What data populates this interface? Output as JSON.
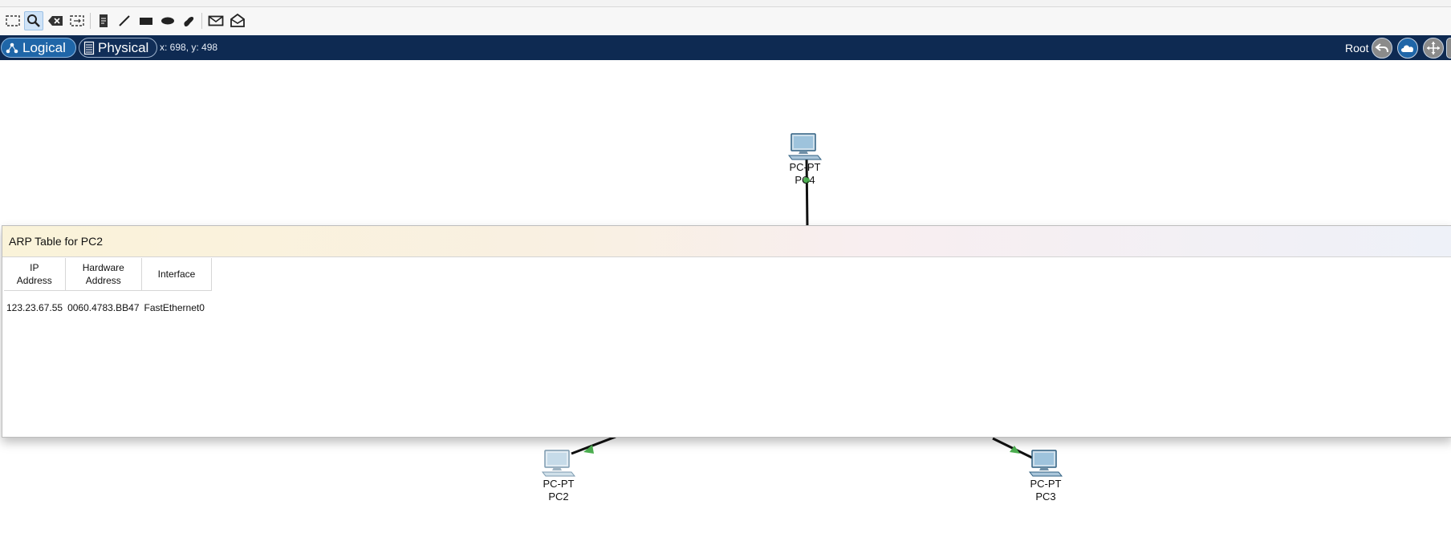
{
  "toolbar": {
    "tools": [
      "select-icon",
      "inspect-icon",
      "delete-icon",
      "resize-icon",
      "note-icon",
      "line-icon",
      "rectangle-icon",
      "ellipse-icon",
      "freeform-icon",
      "simple-pdu-icon",
      "complex-pdu-icon"
    ],
    "active_tool": "inspect-icon"
  },
  "navbar": {
    "logical_label": "Logical",
    "physical_label": "Physical",
    "coordinates": "x: 698, y: 498",
    "root_label": "Root"
  },
  "devices": {
    "pc4": {
      "type": "PC-PT",
      "name": "PC4"
    },
    "pc2": {
      "type": "PC-PT",
      "name": "PC2"
    },
    "pc3": {
      "type": "PC-PT",
      "name": "PC3"
    }
  },
  "arp_window": {
    "title": "ARP Table for PC2",
    "columns": {
      "ip": "IP\nAddress",
      "hw": "Hardware\nAddress",
      "iface": "Interface"
    },
    "rows": [
      {
        "ip": "123.23.67.55",
        "hw": "0060.4783.BB47",
        "iface": "FastEthernet0"
      }
    ]
  },
  "colors": {
    "navbar_bg": "#0e2a52",
    "logical_active": "#1f66a8",
    "link_light": "#4caf50"
  }
}
